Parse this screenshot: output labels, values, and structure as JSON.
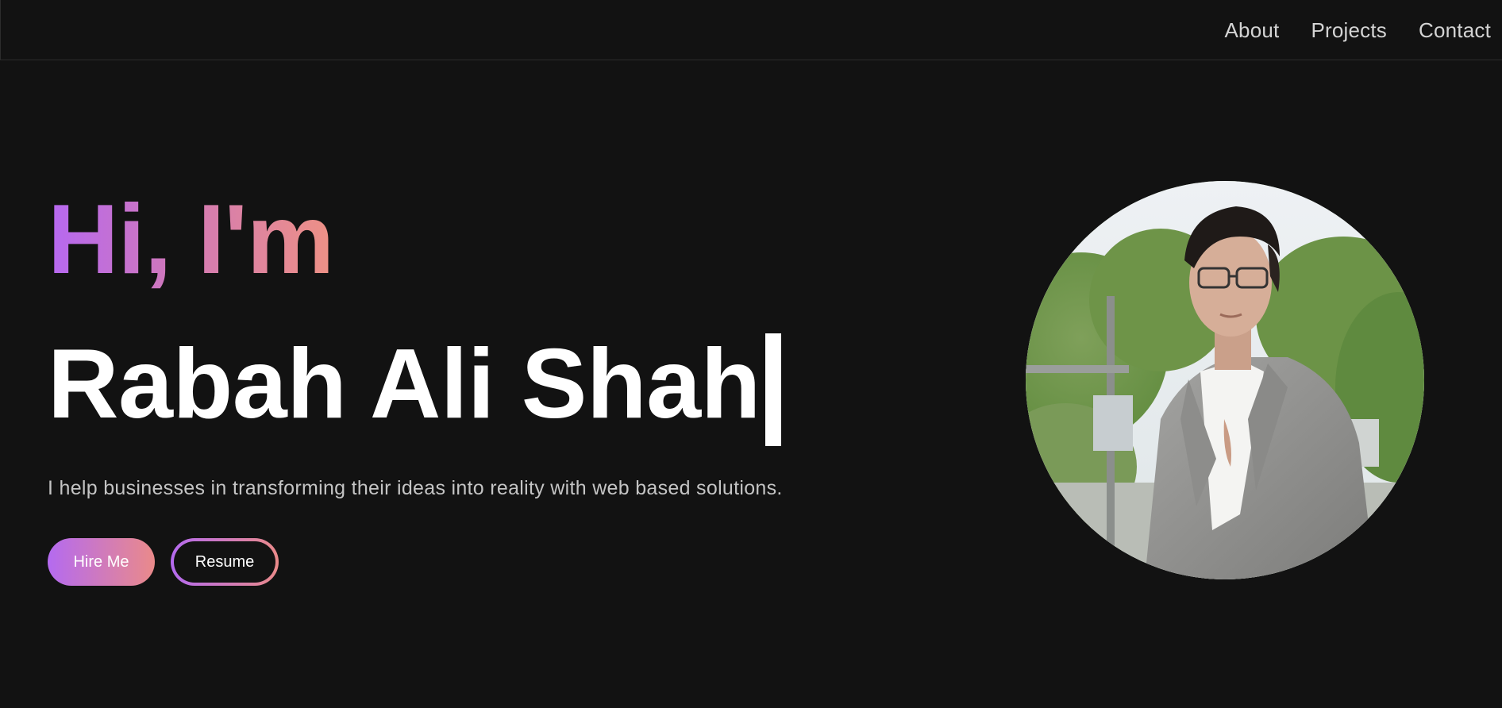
{
  "nav": {
    "items": [
      "About",
      "Projects",
      "Contact"
    ]
  },
  "hero": {
    "greeting": "Hi, I'm",
    "name": "Rabah Ali Shah",
    "tagline": "I help businesses in transforming their ideas into reality with web based solutions.",
    "primary_button": "Hire Me",
    "secondary_button": "Resume"
  },
  "colors": {
    "background": "#121212",
    "gradient_start": "#b668f2",
    "gradient_end": "#ee9185",
    "text": "#ffffff",
    "muted_text": "#c4c4c4"
  },
  "avatar": {
    "icon": "profile-photo"
  }
}
